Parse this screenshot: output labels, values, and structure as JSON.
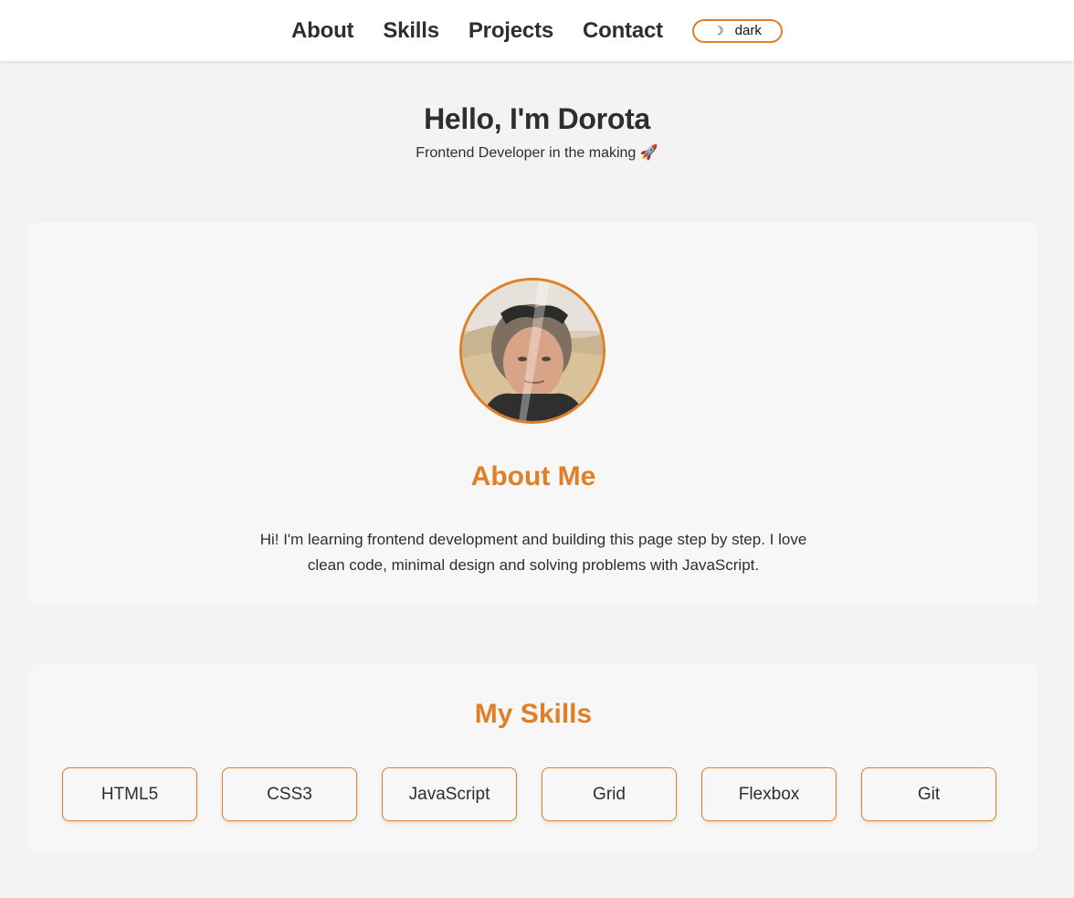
{
  "nav": {
    "items": [
      {
        "label": "About"
      },
      {
        "label": "Skills"
      },
      {
        "label": "Projects"
      },
      {
        "label": "Contact"
      }
    ],
    "theme_toggle": {
      "icon": "moon-icon",
      "label": "dark"
    }
  },
  "hero": {
    "title": "Hello, I'm Dorota",
    "subtitle": "Frontend Developer in the making 🚀"
  },
  "about": {
    "title": "About Me",
    "text": "Hi! I'm learning frontend development and building this page step by step. I love clean code, minimal design and solving problems with JavaScript."
  },
  "skills": {
    "title": "My Skills",
    "items": [
      {
        "label": "HTML5"
      },
      {
        "label": "CSS3"
      },
      {
        "label": "JavaScript"
      },
      {
        "label": "Grid"
      },
      {
        "label": "Flexbox"
      },
      {
        "label": "Git"
      }
    ]
  },
  "colors": {
    "accent": "#e07f26",
    "text": "#2e2e2e",
    "background": "#f3f3f3",
    "card": "#f7f7f7"
  }
}
